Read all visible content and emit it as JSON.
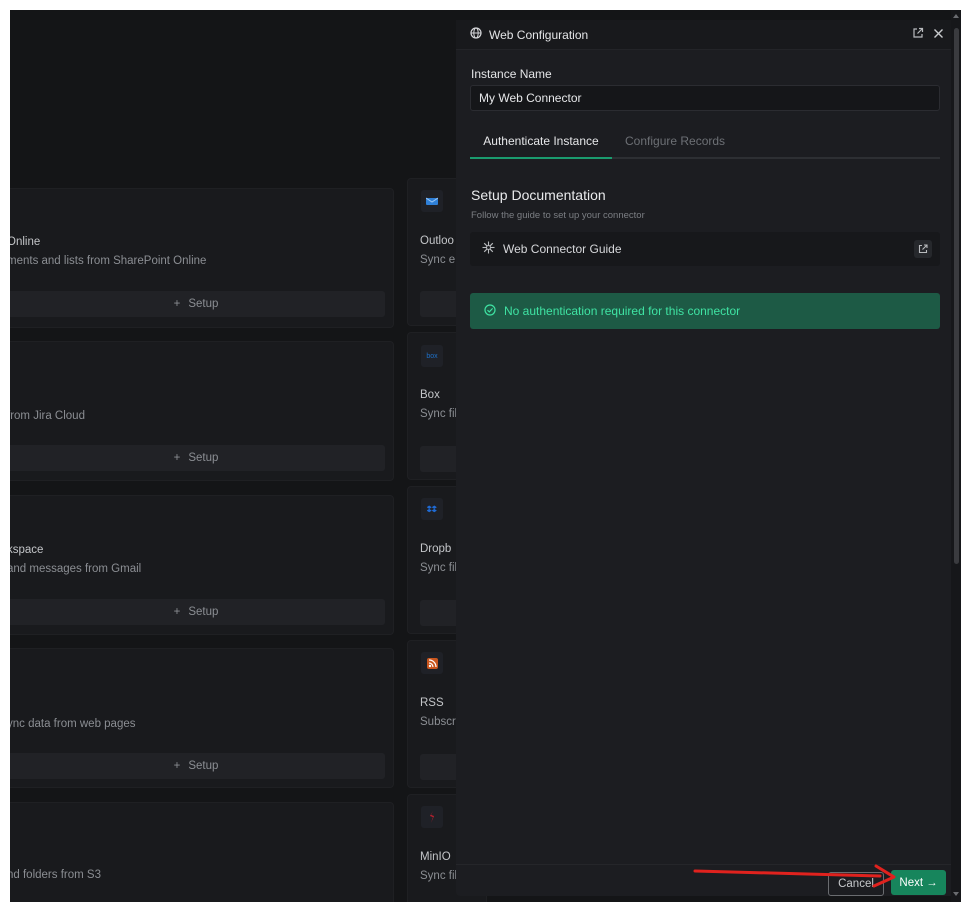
{
  "background": {
    "cards_left": [
      {
        "title": "Online",
        "desc": "ments and lists from SharePoint Online",
        "setup": "Setup"
      },
      {
        "title": "",
        "desc": "from Jira Cloud",
        "setup": "Setup"
      },
      {
        "title": "kspace",
        "desc": "and messages from Gmail",
        "setup": "Setup"
      },
      {
        "title": "",
        "desc": "ync data from web pages",
        "setup": "Setup"
      },
      {
        "title": "",
        "desc": "nd folders from S3",
        "setup": ""
      }
    ],
    "cards_right": [
      {
        "title": "Outloo",
        "desc": "Sync e",
        "icon": "outlook-icon",
        "icon_color": "#2f80d8"
      },
      {
        "title": "Box",
        "desc": "Sync fil",
        "icon": "box-icon",
        "icon_color": "#1e70c8"
      },
      {
        "title": "Dropb",
        "desc": "Sync fil",
        "icon": "dropbox-icon",
        "icon_color": "#1f6bd6"
      },
      {
        "title": "RSS",
        "desc": "Subscr",
        "icon": "rss-icon",
        "icon_color": "#c9561e"
      },
      {
        "title": "MinIO",
        "desc": "Sync fil",
        "icon": "minio-icon",
        "icon_color": "#c8202f"
      }
    ],
    "plus": "+"
  },
  "panel": {
    "title": "Web Configuration",
    "instance_label": "Instance Name",
    "instance_value": "My Web Connector",
    "tabs": [
      "Authenticate Instance",
      "Configure Records"
    ],
    "doc_title": "Setup Documentation",
    "doc_subtitle": "Follow the guide to set up your connector",
    "guide_label": "Web Connector Guide",
    "auth_message": "No authentication required for this connector",
    "cancel_label": "Cancel",
    "next_label": "Next",
    "next_arrow": "→"
  },
  "colors": {
    "accent": "#17855c",
    "success_text": "#3fe3a3",
    "annotation_arrow": "#e0221e"
  }
}
